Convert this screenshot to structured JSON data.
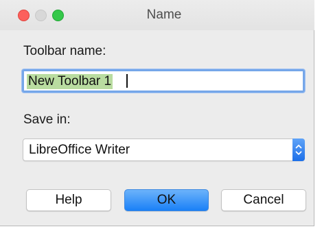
{
  "window": {
    "title": "Name",
    "buttons": [
      "close",
      "minimize",
      "zoom"
    ]
  },
  "form": {
    "toolbar_name_label": "Toolbar name:",
    "toolbar_name_value": "New Toolbar 1",
    "save_in_label": "Save in:",
    "save_in_selected": "LibreOffice Writer"
  },
  "buttons": {
    "help": "Help",
    "ok": "OK",
    "cancel": "Cancel"
  },
  "colors": {
    "accent": "#1a80f7",
    "selection": "#b9dca0",
    "focus_ring": "#76a7e9"
  },
  "icons": {
    "select_stepper": "up-down-chevrons-icon"
  }
}
